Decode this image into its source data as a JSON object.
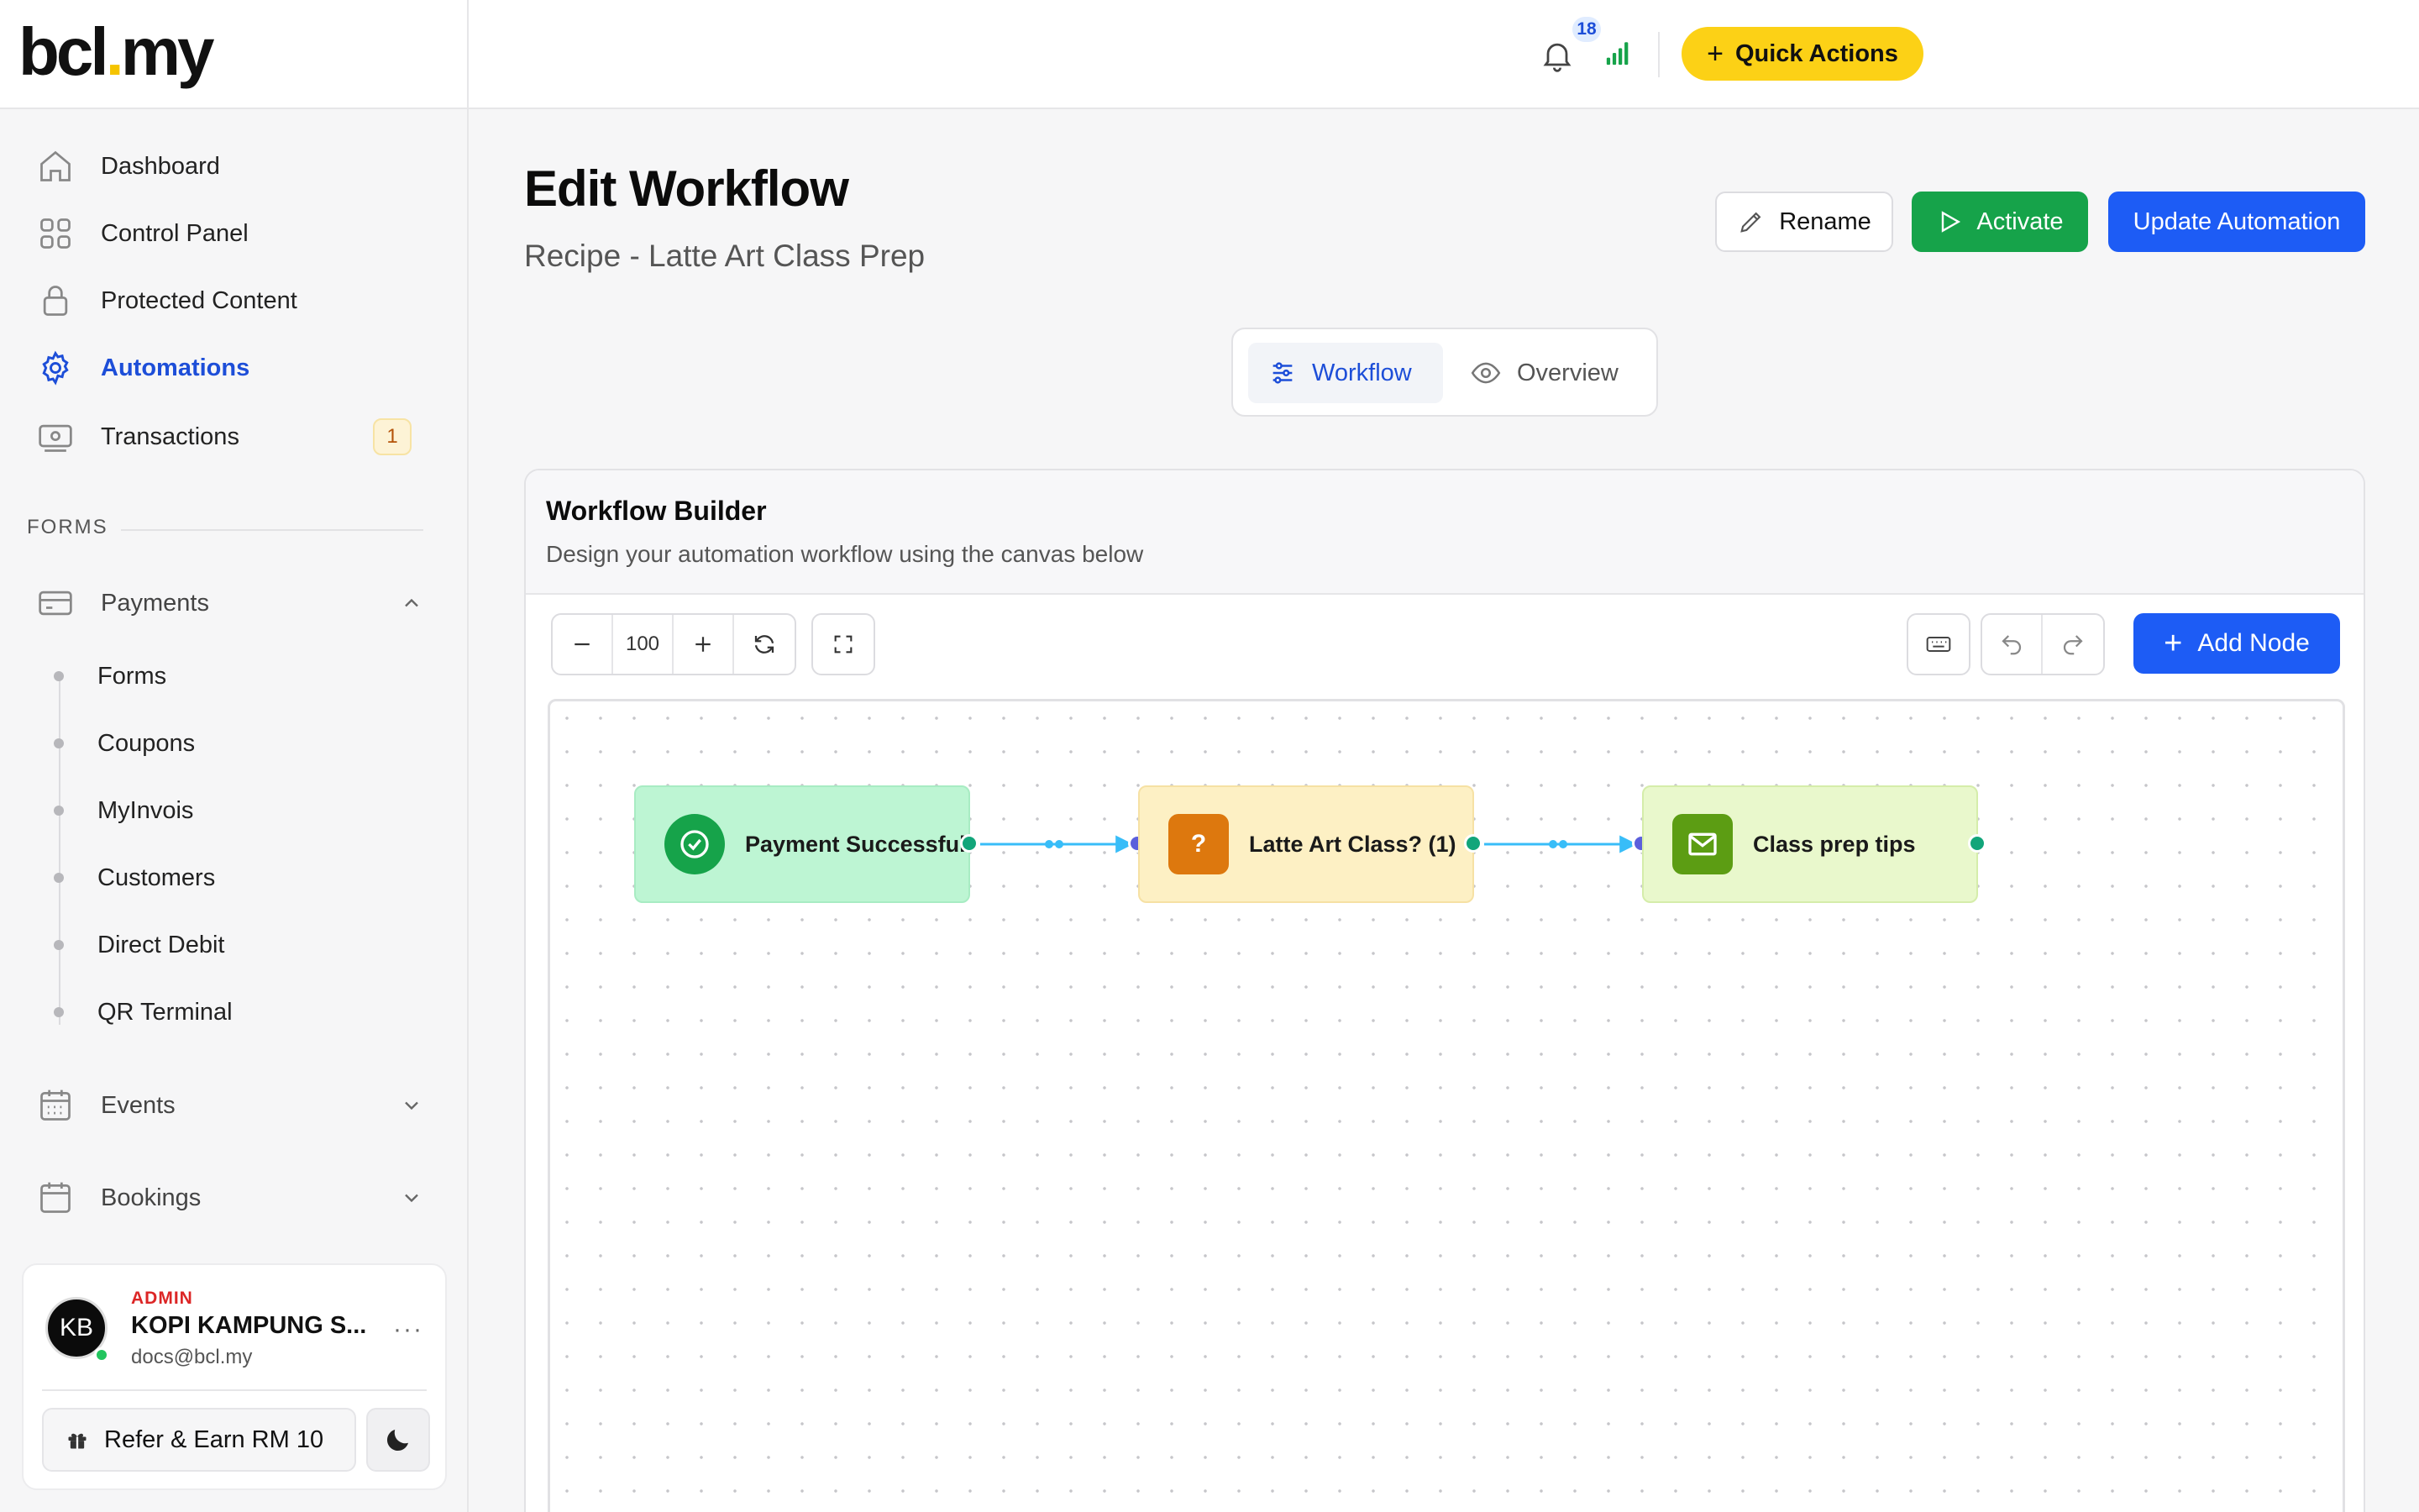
{
  "brand": {
    "logo_left": "bcl",
    "logo_dot": ".",
    "logo_right": "my"
  },
  "sidebar": {
    "nav": [
      {
        "label": "Dashboard",
        "icon": "home-icon"
      },
      {
        "label": "Control Panel",
        "icon": "grid-icon"
      },
      {
        "label": "Protected Content",
        "icon": "lock-icon"
      },
      {
        "label": "Automations",
        "icon": "gear-icon",
        "active": true
      },
      {
        "label": "Transactions",
        "icon": "money-icon",
        "badge": "1"
      }
    ],
    "section_forms": "FORMS",
    "payments": {
      "label": "Payments",
      "items": [
        "Forms",
        "Coupons",
        "MyInvois",
        "Customers",
        "Direct Debit",
        "QR Terminal"
      ]
    },
    "events": {
      "label": "Events"
    },
    "bookings": {
      "label": "Bookings"
    },
    "user": {
      "initials": "KB",
      "role": "ADMIN",
      "org": "KOPI KAMPUNG S...",
      "email": "docs@bcl.my",
      "more": "···",
      "refer_label": "Refer & Earn RM 10"
    }
  },
  "topbar": {
    "notification_count": "18",
    "quick_actions_label": "Quick Actions"
  },
  "page": {
    "title": "Edit Workflow",
    "subtitle": "Recipe - Latte Art Class Prep",
    "rename_label": "Rename",
    "activate_label": "Activate",
    "update_label": "Update Automation"
  },
  "tabs": {
    "workflow": "Workflow",
    "overview": "Overview"
  },
  "builder": {
    "title": "Workflow Builder",
    "description": "Design your automation workflow using the canvas below",
    "zoom": "100",
    "add_node_label": "Add Node",
    "nodes": [
      {
        "label": "Payment Successful",
        "icon": "check-circle-icon"
      },
      {
        "label": "Latte Art Class? (1)",
        "icon": "question-icon",
        "glyph": "?"
      },
      {
        "label": "Class prep tips",
        "icon": "mail-icon"
      }
    ]
  },
  "colors": {
    "accent_blue": "#1d5cf5",
    "activate_green": "#16a34a",
    "quick_yellow": "#fcd116",
    "edge": "#38bdf8"
  }
}
